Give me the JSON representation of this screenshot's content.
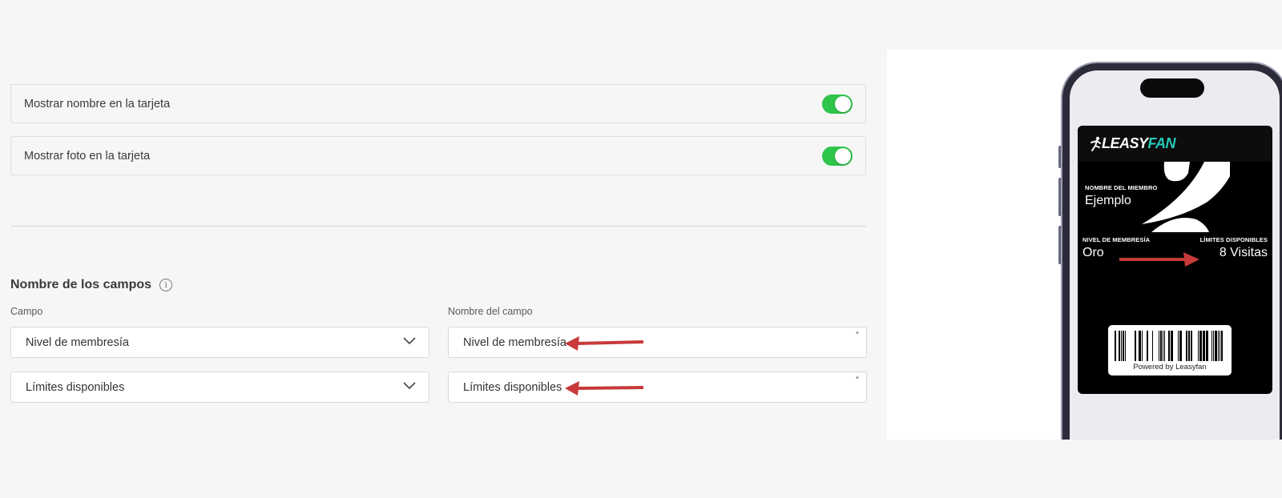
{
  "toggles": [
    {
      "label": "Mostrar nombre en la tarjeta",
      "on": true
    },
    {
      "label": "Mostrar foto en la tarjeta",
      "on": true
    }
  ],
  "section": {
    "title": "Nombre de los campos",
    "info_icon": "info-icon",
    "col_field": "Campo",
    "col_name": "Nombre del campo"
  },
  "rows": [
    {
      "field_select": "Nivel de membresía",
      "field_name": "Nivel de membresía",
      "required_mark": "*"
    },
    {
      "field_select": "Límites disponibles",
      "field_name": "Límites disponibles",
      "required_mark": "*"
    }
  ],
  "card": {
    "logo_left": "LEASY",
    "logo_right": "FAN",
    "member_label": "NOMBRE DEL MIEMBRO",
    "member_value": "Ejemplo",
    "level_label": "NIVEL DE MEMBRESÍA",
    "level_value": "Oro",
    "limits_label": "LÍMITES DISPONIBLES",
    "limits_value": "8 Visitas",
    "powered": "Powered by Leasyfan"
  },
  "colors": {
    "toggle_on": "#2fc44a",
    "accent_teal": "#25c9b7",
    "annotation_arrow": "#c83a3a"
  }
}
